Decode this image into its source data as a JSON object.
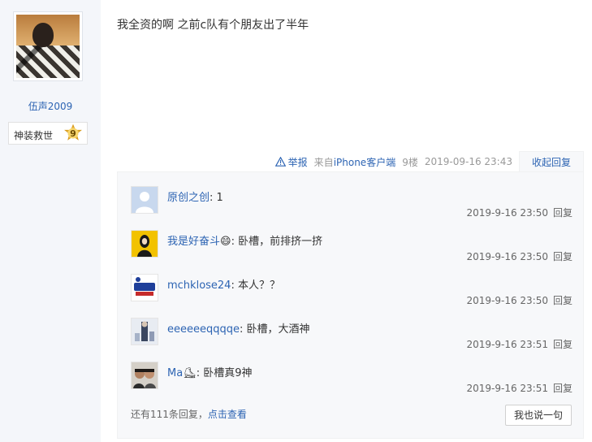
{
  "author": {
    "username": "伍声2009",
    "badge_name": "神装救世",
    "badge_level": "9"
  },
  "post": {
    "content": "我全资的啊 之前c队有个朋友出了半年",
    "report_label": "举报",
    "client_prefix": "来自",
    "client_name": "iPhone客户端",
    "floor": "9楼",
    "time": "2019-09-16 23:43",
    "collapse_label": "收起回复"
  },
  "replies": [
    {
      "user": "原创之创",
      "sep": ": ",
      "text": "1",
      "time": "2019-9-16 23:50",
      "reply_label": "回复"
    },
    {
      "user": "我是好奋斗",
      "emoji": "😄",
      "sep": ": ",
      "text": "卧槽，前排挤一挤",
      "time": "2019-9-16 23:50",
      "reply_label": "回复"
    },
    {
      "user": "mchklose24",
      "sep": ": ",
      "text": "本人？？",
      "time": "2019-9-16 23:50",
      "reply_label": "回复"
    },
    {
      "user": "eeeeeeqqqqe",
      "sep": ": ",
      "text": "卧槽，大酒神",
      "time": "2019-9-16 23:51",
      "reply_label": "回复"
    },
    {
      "user": "Ma",
      "emoji": "⛸",
      "sep": ": ",
      "text": "卧槽真9神",
      "time": "2019-9-16 23:51",
      "reply_label": "回复"
    }
  ],
  "footer": {
    "more_prefix": "还有111条回复，",
    "more_link": "点击查看",
    "say_button": "我也说一句"
  },
  "colors": {
    "link": "#2d64b3",
    "sidebar_bg": "#f4f6fa",
    "reply_bg": "#f7f8fa"
  }
}
